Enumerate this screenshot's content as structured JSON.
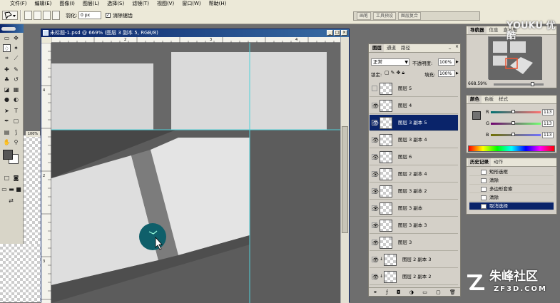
{
  "menu": [
    "文件(F)",
    "编辑(E)",
    "图像(I)",
    "图层(L)",
    "选择(S)",
    "滤镜(T)",
    "视图(V)",
    "窗口(W)",
    "帮助(H)"
  ],
  "options": {
    "feather_label": "羽化:",
    "feather_value": "0 px",
    "antialias_label": "消除锯齿"
  },
  "well_tabs": [
    "画笔",
    "工具预设",
    "图层复合"
  ],
  "document": {
    "title": "未标题-1.psd @ 669% (图层 3 副本 5, RGB/8)",
    "ruler_marks": [
      "2",
      "3",
      "4",
      "5"
    ],
    "vruler_marks": [
      "4",
      "2",
      "3",
      "1",
      "2"
    ]
  },
  "layers_panel": {
    "tabs": [
      "图层",
      "通道",
      "路径"
    ],
    "blend_mode": "正常",
    "opacity_label": "不透明度:",
    "opacity_value": "100%",
    "lock_label": "锁定:",
    "fill_label": "填充:",
    "fill_value": "100%",
    "layers": [
      {
        "name": "图层 5",
        "visible": false,
        "selected": false
      },
      {
        "name": "图层 4",
        "visible": true,
        "selected": false
      },
      {
        "name": "图层 3 副本 5",
        "visible": true,
        "selected": true
      },
      {
        "name": "图层 3 副本 4",
        "visible": true,
        "selected": false
      },
      {
        "name": "图层 6",
        "visible": true,
        "selected": false
      },
      {
        "name": "图层 2 副本 4",
        "visible": true,
        "selected": false
      },
      {
        "name": "图层 3 副本 2",
        "visible": true,
        "selected": false
      },
      {
        "name": "图层 3 副本",
        "visible": true,
        "selected": false
      },
      {
        "name": "图层 3 副本 3",
        "visible": true,
        "selected": false
      },
      {
        "name": "图层 3",
        "visible": true,
        "selected": false
      },
      {
        "name": "图层 2 副本 3",
        "visible": true,
        "selected": false
      },
      {
        "name": "图层 2 副本 2",
        "visible": true,
        "selected": false
      }
    ]
  },
  "navigator": {
    "tabs": [
      "导航器",
      "信息",
      "直方图"
    ],
    "zoom": "668.59%"
  },
  "color_panel": {
    "tabs": [
      "颜色",
      "色板",
      "样式"
    ],
    "channels": [
      {
        "label": "R",
        "value": "113"
      },
      {
        "label": "G",
        "value": "113"
      },
      {
        "label": "B",
        "value": "113"
      }
    ]
  },
  "history_panel": {
    "tabs": [
      "历史记录",
      "动作"
    ],
    "items": [
      {
        "label": "矩形选框",
        "selected": false
      },
      {
        "label": "清除",
        "selected": false
      },
      {
        "label": "多边形套索",
        "selected": false
      },
      {
        "label": "清除",
        "selected": false
      },
      {
        "label": "取消选择",
        "selected": true
      }
    ]
  },
  "watermark_top": "YOUKU 优酷",
  "watermark_bottom": {
    "name": "朱峰社区",
    "url": "ZF3D.COM"
  },
  "colors": {
    "selection": "#0a246a",
    "panel": "#d4d0c8",
    "canvas_dark": "#5a5a5a",
    "guide": "#4fd1d9",
    "cursor_circle": "#0f5f6a"
  }
}
